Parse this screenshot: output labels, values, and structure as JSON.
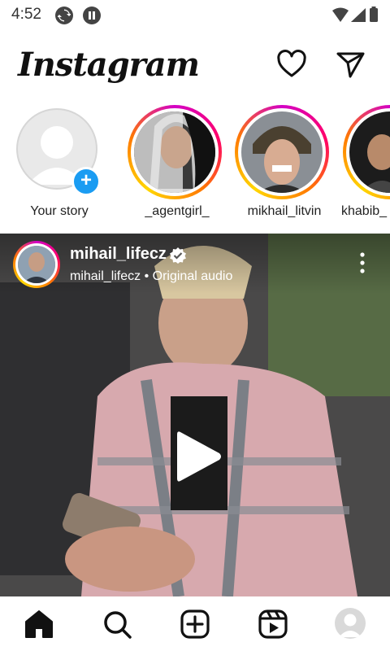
{
  "status_bar": {
    "time": "4:52",
    "icons": [
      "sync-icon",
      "pause-icon",
      "wifi-icon",
      "signal-icon",
      "battery-icon"
    ]
  },
  "header": {
    "logo": "Instagram",
    "icons": [
      "heart-icon",
      "direct-message-icon"
    ]
  },
  "stories": [
    {
      "name": "Your story",
      "type": "own",
      "add_badge": "+"
    },
    {
      "name": "_agentgirl_",
      "type": "story"
    },
    {
      "name": "mikhail_litvin",
      "type": "story"
    },
    {
      "name": "khabib_",
      "type": "story"
    }
  ],
  "post": {
    "username": "mihail_lifecz",
    "verified": true,
    "subtitle": "mihail_lifecz • Original audio",
    "icons": [
      "verified-icon",
      "more-options-icon",
      "play-icon"
    ]
  },
  "bottom_nav": {
    "items": [
      "home",
      "search",
      "create",
      "reels",
      "profile"
    ],
    "active": "home"
  },
  "colors": {
    "story_ring": [
      "#d300c5",
      "#ff0069",
      "#ff7a00",
      "#ffd600"
    ],
    "add_badge": "#1a9cf2",
    "text": "#222222"
  }
}
